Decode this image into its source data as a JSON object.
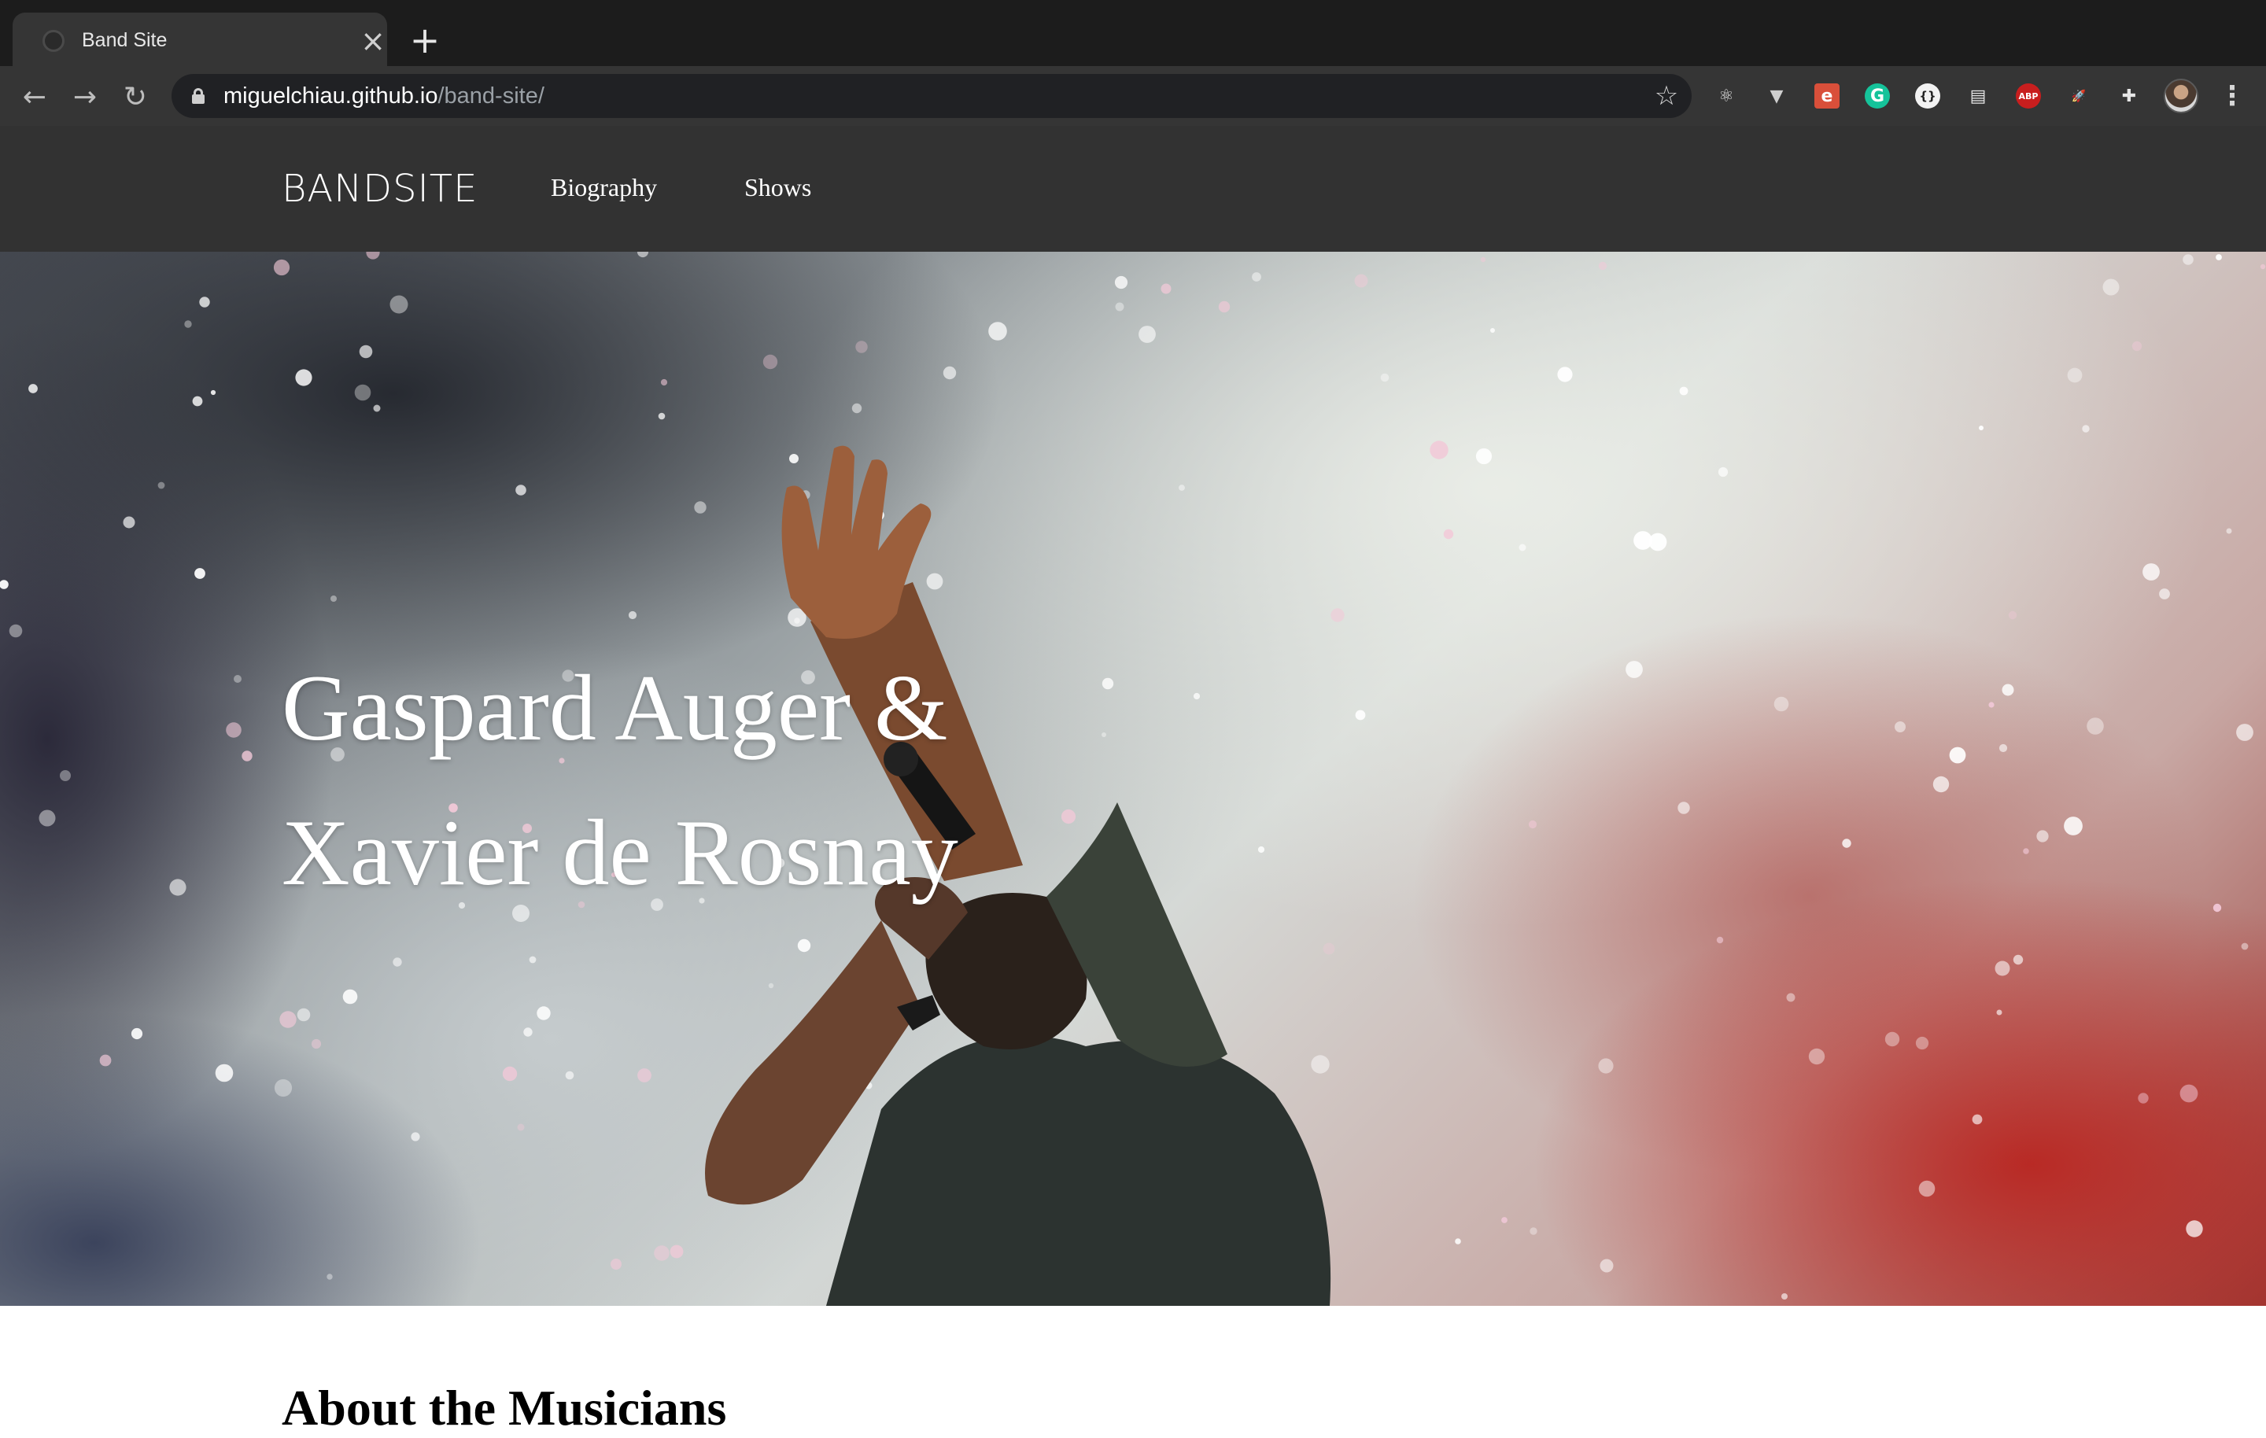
{
  "browser": {
    "tab_title": "Band Site",
    "url_host": "miguelchiau.github.io",
    "url_path": "/band-site/",
    "extensions": [
      {
        "name": "react-devtools-icon",
        "glyph": "⚛",
        "color": "#e0e0e0",
        "bg": "transparent"
      },
      {
        "name": "vue-devtools-icon",
        "glyph": "▼",
        "color": "#cfcfcf",
        "bg": "transparent"
      },
      {
        "name": "evernote-icon",
        "glyph": "e",
        "color": "#ffffff",
        "bg": "#d94f3a"
      },
      {
        "name": "grammarly-icon",
        "glyph": "G",
        "color": "#ffffff",
        "bg": "#15c39a"
      },
      {
        "name": "json-viewer-icon",
        "glyph": "{}",
        "color": "#222222",
        "bg": "#f2f2f2"
      },
      {
        "name": "document-icon",
        "glyph": "▤",
        "color": "#e6e6e6",
        "bg": "transparent"
      },
      {
        "name": "adblock-plus-icon",
        "glyph": "ABP",
        "color": "#ffffff",
        "bg": "#c81e1e"
      },
      {
        "name": "rocket-icon",
        "glyph": "🚀",
        "color": "#7fb2ff",
        "bg": "transparent"
      },
      {
        "name": "extensions-puzzle-icon",
        "glyph": "✚",
        "color": "#e6e6e6",
        "bg": "transparent"
      }
    ]
  },
  "site": {
    "logo": "BANDSITE",
    "nav": [
      {
        "label": "Biography"
      },
      {
        "label": "Shows"
      }
    ],
    "hero": {
      "title_line1": "Gaspard Auger &",
      "title_line2": "Xavier de Rosnay"
    },
    "section_title": "About the Musicians"
  }
}
